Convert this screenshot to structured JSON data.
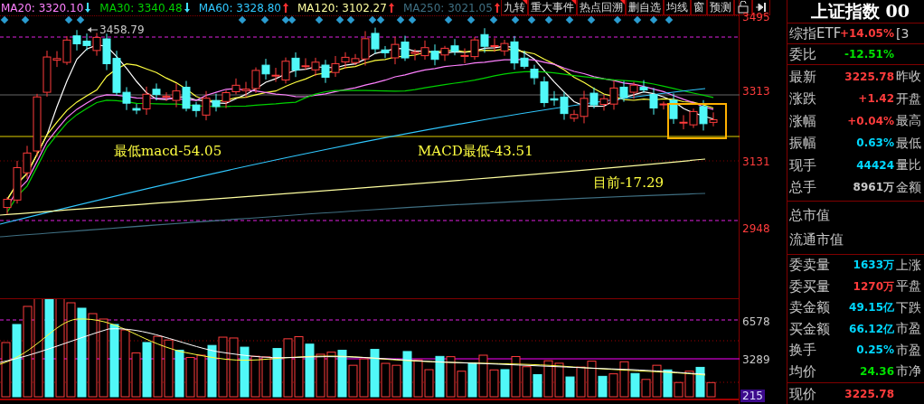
{
  "ma_legend": [
    {
      "label": "MA20: 3320.10",
      "color": "#ff80ff",
      "rising": false
    },
    {
      "label": "MA30: 3340.48",
      "color": "#00d000",
      "rising": false
    },
    {
      "label": "MA60: 3328.80",
      "color": "#30c8ff",
      "rising": true
    },
    {
      "label": "MA120: 3102.27",
      "color": "#ffffa0",
      "rising": true
    },
    {
      "label": "MA250: 3021.05",
      "color": "#3f6f82",
      "rising": true
    }
  ],
  "toolbar": [
    {
      "kind": "text",
      "label": "九转",
      "flagged": true
    },
    {
      "kind": "text",
      "label": "重大事件",
      "flagged": true
    },
    {
      "kind": "text",
      "label": "热点回溯",
      "flagged": true
    },
    {
      "kind": "text",
      "label": "删自选",
      "flagged": false
    },
    {
      "kind": "text",
      "label": "均线",
      "flagged": false
    },
    {
      "kind": "text",
      "label": "窗",
      "flagged": false
    },
    {
      "kind": "text",
      "label": "预测",
      "flagged": false
    },
    {
      "kind": "lock"
    },
    {
      "kind": "collapse"
    }
  ],
  "price_chart": {
    "peak_label": "3458.79",
    "notes": [
      "最低macd-54.05",
      "MACD最低-43.51",
      "目前-17.29"
    ]
  },
  "price_axis": [
    "3495",
    "3313",
    "3131",
    "2948"
  ],
  "volume_axis": [
    {
      "label": "6578",
      "selected": false
    },
    {
      "label": "3289",
      "selected": false
    },
    {
      "label": "215",
      "selected": true
    }
  ],
  "quote": {
    "title": "上证指数 00",
    "head_rows": [
      {
        "label": "综指ETF",
        "value": "+14.05%",
        "color": "#ff3c3c",
        "extra": "[3"
      },
      {
        "label": "委比",
        "value": "-12.51%",
        "color": "#00e000"
      }
    ],
    "rows": [
      {
        "label": "最新",
        "value": "3225.78",
        "color": "#ff3c3c",
        "extra": "昨收"
      },
      {
        "label": "涨跌",
        "value": "+1.42",
        "color": "#ff3c3c",
        "extra": "开盘"
      },
      {
        "label": "涨幅",
        "value": "+0.04%",
        "color": "#ff3c3c",
        "extra": "最高"
      },
      {
        "label": "振幅",
        "value": "0.63%",
        "color": "#00d8ff",
        "extra": "最低"
      },
      {
        "label": "现手",
        "value": "44424",
        "color": "#00d8ff",
        "extra": "量比"
      },
      {
        "label": "总手",
        "value": "8961万",
        "color": "#c8c8c8",
        "extra": "金额"
      }
    ],
    "cap_rows": [
      "总市值",
      "流通市值"
    ],
    "order_rows": [
      {
        "label": "委卖量",
        "value": "1633万",
        "color": "#00d8ff",
        "extra": "上涨"
      },
      {
        "label": "委买量",
        "value": "1270万",
        "color": "#ff3c3c",
        "extra": "平盘"
      },
      {
        "label": "卖金额",
        "value": "49.15亿",
        "color": "#00d8ff",
        "extra": "下跌"
      },
      {
        "label": "买金额",
        "value": "66.12亿",
        "color": "#00d8ff",
        "extra": "市盈"
      },
      {
        "label": "换手",
        "value": "0.25%",
        "color": "#00d8ff",
        "extra": "市盈"
      },
      {
        "label": "均价",
        "value": "24.36",
        "color": "#00e000",
        "extra": "市净"
      }
    ],
    "footer": {
      "label": "现价",
      "value": "3225.78",
      "color": "#ff3c3c"
    }
  }
}
